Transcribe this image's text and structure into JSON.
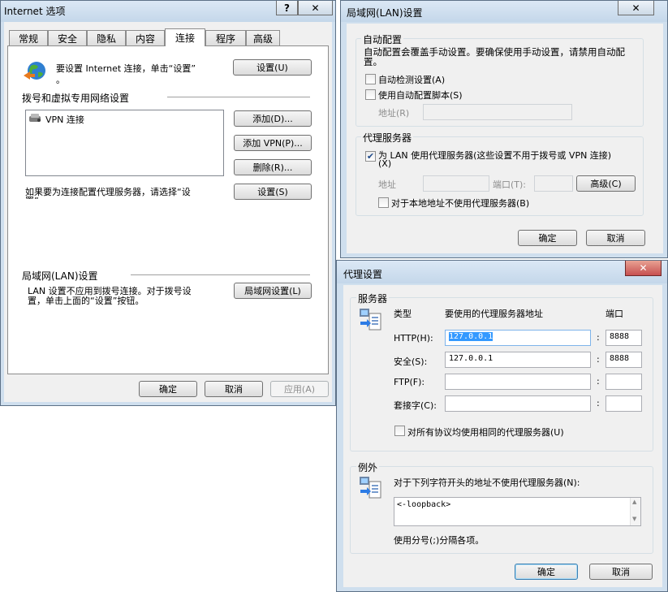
{
  "internet_options": {
    "title": "Internet 选项",
    "help_label": "?",
    "close_label": "✕",
    "tabs": [
      "常规",
      "安全",
      "隐私",
      "内容",
      "连接",
      "程序",
      "高级"
    ],
    "setup_text": "要设置 Internet 连接，单击“设置”",
    "setup_text_2": "。",
    "setup_button": "设置(U)",
    "dialup_section": "拨号和虚拟专用网络设置",
    "vpn_item": "VPN 连接",
    "add_button": "添加(D)...",
    "add_vpn_button": "添加 VPN(P)...",
    "remove_button": "删除(R)...",
    "proxy_hint": "如果要为连接配置代理服务器，请选择“设",
    "proxy_hint_2": "置”。",
    "settings_button": "设置(S)",
    "lan_section": "局域网(LAN)设置",
    "lan_text_1": "LAN 设置不应用到拨号连接。对于拨号设",
    "lan_text_2": "置，单击上面的“设置”按钮。",
    "lan_button": "局域网设置(L)",
    "ok": "确定",
    "cancel": "取消",
    "apply": "应用(A)"
  },
  "lan_settings": {
    "title": "局域网(LAN)设置",
    "close_label": "✕",
    "auto_group": "自动配置",
    "auto_desc": "自动配置会覆盖手动设置。要确保使用手动设置，请禁用自动配",
    "auto_desc_2": "置。",
    "auto_detect": "自动检测设置(A)",
    "auto_script": "使用自动配置脚本(S)",
    "address_label": "地址(R)",
    "proxy_group": "代理服务器",
    "use_proxy": "为 LAN 使用代理服务器(这些设置不用于拨号或 VPN 连接)",
    "use_proxy_2": "(X)",
    "use_proxy_checked": true,
    "addr_label": "地址",
    "port_label": "端口(T):",
    "advanced_button": "高级(C)",
    "bypass_local": "对于本地地址不使用代理服务器(B)",
    "ok": "确定",
    "cancel": "取消"
  },
  "proxy_settings": {
    "title": "代理设置",
    "close_label": "✕",
    "servers_group": "服务器",
    "col_type": "类型",
    "col_address": "要使用的代理服务器地址",
    "col_port": "端口",
    "rows": [
      {
        "type": "HTTP(H):",
        "address": "127.0.0.1",
        "port": "8888"
      },
      {
        "type": "安全(S):",
        "address": "127.0.0.1",
        "port": "8888"
      },
      {
        "type": "FTP(F):",
        "address": "",
        "port": ""
      },
      {
        "type": "套接字(C):",
        "address": "",
        "port": ""
      }
    ],
    "colon": ":",
    "same_proxy": "对所有协议均使用相同的代理服务器(U)",
    "exceptions_group": "例外",
    "exceptions_desc": "对于下列字符开头的地址不使用代理服务器(N):",
    "exceptions_value": "<-loopback>",
    "separator_hint": "使用分号(;)分隔各项。",
    "ok": "确定",
    "cancel": "取消"
  },
  "colors": {
    "title_glass": "#c9dbec",
    "close_red": "#c75050",
    "selection": "#3399ff"
  }
}
